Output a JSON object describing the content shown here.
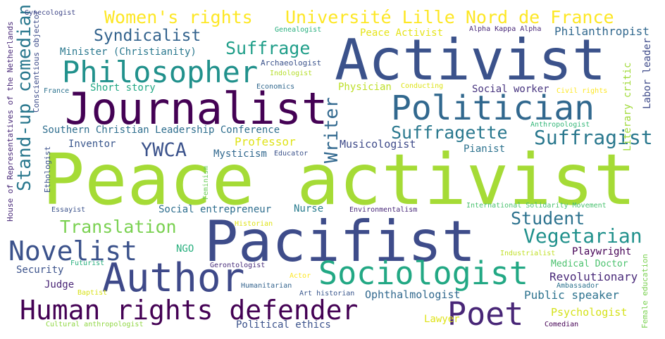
{
  "words": [
    {
      "text": "Peace activist",
      "color": "#a5db36"
    },
    {
      "text": "Pacifist",
      "color": "#3e4c8a"
    },
    {
      "text": "Activist",
      "color": "#3b528b"
    },
    {
      "text": "Journalist",
      "color": "#440154"
    },
    {
      "text": "Author",
      "color": "#3e4989"
    },
    {
      "text": "Politician",
      "color": "#31688e"
    },
    {
      "text": "Philosopher",
      "color": "#21918c"
    },
    {
      "text": "Sociologist",
      "color": "#22a884"
    },
    {
      "text": "Human rights defender",
      "color": "#440154"
    },
    {
      "text": "Poet",
      "color": "#482677"
    },
    {
      "text": "Novelist",
      "color": "#3b528b"
    },
    {
      "text": "Women's rights",
      "color": "#fde725"
    },
    {
      "text": "Université Lille Nord de France",
      "color": "#fde725"
    },
    {
      "text": "Writer",
      "color": "#31688e"
    },
    {
      "text": "Stand-up comedian",
      "color": "#2a788e"
    },
    {
      "text": "Suffragette",
      "color": "#2a788e"
    },
    {
      "text": "Suffragist",
      "color": "#2a788e"
    },
    {
      "text": "Vegetarian",
      "color": "#21918c"
    },
    {
      "text": "Student",
      "color": "#2c728e"
    },
    {
      "text": "Translation",
      "color": "#7ad151"
    },
    {
      "text": "YWCA",
      "color": "#3b528b"
    },
    {
      "text": "Syndicalist",
      "color": "#33638d"
    },
    {
      "text": "Suffrage",
      "color": "#1f9e89"
    },
    {
      "text": "Philanthropist",
      "color": "#31688e"
    },
    {
      "text": "Playwright",
      "color": "#440154"
    },
    {
      "text": "Revolutionary",
      "color": "#482878"
    },
    {
      "text": "Professor",
      "color": "#dfe318"
    },
    {
      "text": "Musicologist",
      "color": "#3e4a89"
    },
    {
      "text": "Physician",
      "color": "#bddf26"
    },
    {
      "text": "Southern Christian Leadership Conference",
      "color": "#2e6e8e"
    },
    {
      "text": "Mysticism",
      "color": "#31688e"
    },
    {
      "text": "Social worker",
      "color": "#46337e"
    },
    {
      "text": "Public speaker",
      "color": "#2c728e"
    },
    {
      "text": "Ophthalmologist",
      "color": "#31688e"
    },
    {
      "text": "Psychologist",
      "color": "#d5e21a"
    },
    {
      "text": "Social entrepreneur",
      "color": "#2e6e8e"
    },
    {
      "text": "Nurse",
      "color": "#287c8e"
    },
    {
      "text": "Medical Doctor",
      "color": "#4ac16d"
    },
    {
      "text": "Political ethics",
      "color": "#3b528b"
    },
    {
      "text": "Security",
      "color": "#3b528b"
    },
    {
      "text": "Short story",
      "color": "#22a884"
    },
    {
      "text": "Minister (Christianity)",
      "color": "#2a788e"
    },
    {
      "text": "Inventor",
      "color": "#39568c"
    },
    {
      "text": "Pianist",
      "color": "#2c728e"
    },
    {
      "text": "Judge",
      "color": "#482475"
    },
    {
      "text": "Lawyer",
      "color": "#dfe318"
    },
    {
      "text": "NGO",
      "color": "#2ab07f"
    },
    {
      "text": "Peace Activist",
      "color": "#e5e419"
    },
    {
      "text": "Literary critic",
      "color": "#a0da39"
    },
    {
      "text": "Labor leader",
      "color": "#3e4a89"
    },
    {
      "text": "Female education",
      "color": "#7ad151"
    },
    {
      "text": "House of Representatives of the Netherlands",
      "color": "#482878"
    },
    {
      "text": "Conscientious objector",
      "color": "#3e4c8a"
    },
    {
      "text": "Ethologist",
      "color": "#3b528b"
    },
    {
      "text": "Feminism",
      "color": "#6ccd5a"
    },
    {
      "text": "Gynecologist",
      "color": "#3f4788"
    },
    {
      "text": "Genealogist",
      "color": "#29af7f"
    },
    {
      "text": "Alpha Kappa Alpha",
      "color": "#482878"
    },
    {
      "text": "Archaeologist",
      "color": "#3b528b"
    },
    {
      "text": "Indologist",
      "color": "#b5de2b"
    },
    {
      "text": "Economics",
      "color": "#31688e"
    },
    {
      "text": "France",
      "color": "#2c728e"
    },
    {
      "text": "Conducting",
      "color": "#dde318"
    },
    {
      "text": "Civil rights",
      "color": "#fde725"
    },
    {
      "text": "Anthropologist",
      "color": "#35b779"
    },
    {
      "text": "Educator",
      "color": "#3b528b"
    },
    {
      "text": "Essayist",
      "color": "#3b528b"
    },
    {
      "text": "Environmentalism",
      "color": "#482878"
    },
    {
      "text": "International Solidarity Movement",
      "color": "#48c16e"
    },
    {
      "text": "Historian",
      "color": "#dfe318"
    },
    {
      "text": "Industrialist",
      "color": "#c0df25"
    },
    {
      "text": "Futurist",
      "color": "#2ab07f"
    },
    {
      "text": "Gerontologist",
      "color": "#472c7a"
    },
    {
      "text": "Actor",
      "color": "#fde725"
    },
    {
      "text": "Humanitarian",
      "color": "#33638d"
    },
    {
      "text": "Art historian",
      "color": "#39568c"
    },
    {
      "text": "Ambassador",
      "color": "#2c728e"
    },
    {
      "text": "Baptist",
      "color": "#d8e219"
    },
    {
      "text": "Cultural anthropologist",
      "color": "#90d743"
    },
    {
      "text": "Comedian",
      "color": "#440154"
    }
  ]
}
